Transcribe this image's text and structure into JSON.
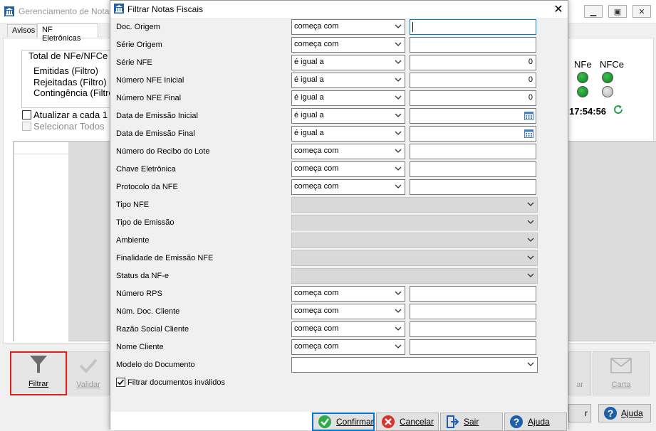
{
  "background_window": {
    "title": "Gerenciamento de Notas",
    "tabs": [
      "Avisos",
      "NF Eletrônicas"
    ],
    "totals_group": {
      "label": "Total de NFe/NFCe",
      "lines": [
        "Emitidas (Filtro)",
        "Rejeitadas (Filtro)",
        "Contingência (Filtro"
      ]
    },
    "auto_update_label": "Atualizar a cada 1",
    "select_all_label": "Selecionar Todos",
    "status_headers": [
      "NFe",
      "NFCe"
    ],
    "clock": "17:54:56",
    "toolbar": {
      "filtrar": "Filtrar",
      "validar": "Validar",
      "enviar_partial": "ar",
      "carta": "Carta"
    },
    "footer_partial_button": "r",
    "ajuda": "Ajuda"
  },
  "dialog": {
    "title": "Filtrar Notas Fiscais",
    "fields": [
      {
        "label": "Doc. Origem",
        "op": "começa com",
        "value": ""
      },
      {
        "label": "Série Origem",
        "op": "começa com",
        "value": ""
      },
      {
        "label": "Série NFE",
        "op": "é igual a",
        "value": "0"
      },
      {
        "label": "Número NFE Inicial",
        "op": "é igual a",
        "value": "0"
      },
      {
        "label": "Número NFE Final",
        "op": "é igual a",
        "value": "0"
      },
      {
        "label": "Data de Emissão Inicial",
        "op": "é igual a",
        "value": ""
      },
      {
        "label": "Data de Emissão Final",
        "op": "é igual a",
        "value": ""
      },
      {
        "label": "Número do Recibo do Lote",
        "op": "começa com",
        "value": ""
      },
      {
        "label": "Chave Eletrônica",
        "op": "começa com",
        "value": ""
      },
      {
        "label": "Protocolo da NFE",
        "op": "começa com",
        "value": ""
      },
      {
        "label": "Tipo NFE"
      },
      {
        "label": "Tipo de Emissão"
      },
      {
        "label": "Ambiente"
      },
      {
        "label": "Finalidade de Emissão NFE"
      },
      {
        "label": "Status da NF-e"
      },
      {
        "label": "Número RPS",
        "op": "começa com",
        "value": ""
      },
      {
        "label": "Núm. Doc. Cliente",
        "op": "começa com",
        "value": ""
      },
      {
        "label": "Razão Social Cliente",
        "op": "começa com",
        "value": ""
      },
      {
        "label": "Nome Cliente",
        "op": "começa com",
        "value": ""
      },
      {
        "label": "Modelo do Documento"
      }
    ],
    "checkbox_label": "Filtrar documentos inválidos",
    "checkbox_checked": true,
    "buttons": {
      "confirmar": "Confirmar",
      "cancelar": "Cancelar",
      "sair": "Sair",
      "ajuda": "Ajuda"
    }
  },
  "colors": {
    "focus_blue": "#0078d7",
    "led_green": "#0b7a1c",
    "highlight_red": "#e0201c"
  }
}
